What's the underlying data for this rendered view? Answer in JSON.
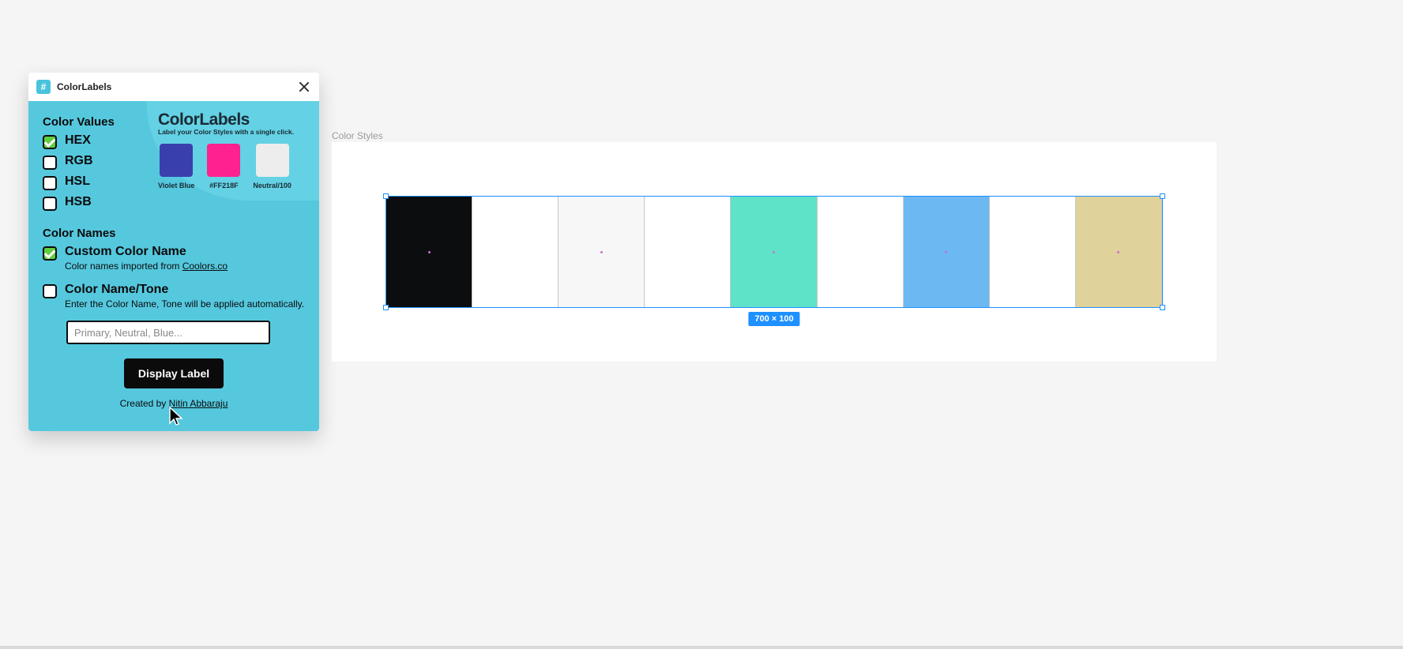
{
  "plugin": {
    "title": "ColorLabels",
    "close_aria": "Close",
    "brand": {
      "title": "ColorLabels",
      "subtitle": "Label your Color Styles with a single click.",
      "swatches": [
        {
          "label": "Violet Blue",
          "color": "#3a3fae"
        },
        {
          "label": "#FF218F",
          "color": "#ff218f"
        },
        {
          "label": "Neutral/100",
          "color": "#ededed"
        }
      ]
    },
    "values_heading": "Color Values",
    "values": [
      {
        "label": "HEX",
        "checked": true
      },
      {
        "label": "RGB",
        "checked": false
      },
      {
        "label": "HSL",
        "checked": false
      },
      {
        "label": "HSB",
        "checked": false
      }
    ],
    "names_heading": "Color Names",
    "custom_name": {
      "label": "Custom Color Name",
      "sub_pre": "Color names imported from ",
      "sub_link": "Coolors.co",
      "checked": true
    },
    "name_tone": {
      "label": "Color Name/Tone",
      "sub": "Enter the Color Name, Tone will be applied automatically.",
      "checked": false
    },
    "input_placeholder": "Primary, Neutral, Blue...",
    "button_label": "Display Label",
    "credits_pre": "Created by ",
    "credits_link": "Nitin Abbaraju"
  },
  "canvas": {
    "frame_label": "Color Styles",
    "selection_badge": "700 × 100",
    "cells": [
      {
        "color": "#0b0d0e"
      },
      {
        "color": "#ffffff"
      },
      {
        "color": "#f7f7f7"
      },
      {
        "color": "#ffffff"
      },
      {
        "color": "#5fe3c8"
      },
      {
        "color": "#ffffff"
      },
      {
        "color": "#6cb8f3"
      },
      {
        "color": "#ffffff"
      },
      {
        "color": "#e0d29b"
      }
    ]
  }
}
